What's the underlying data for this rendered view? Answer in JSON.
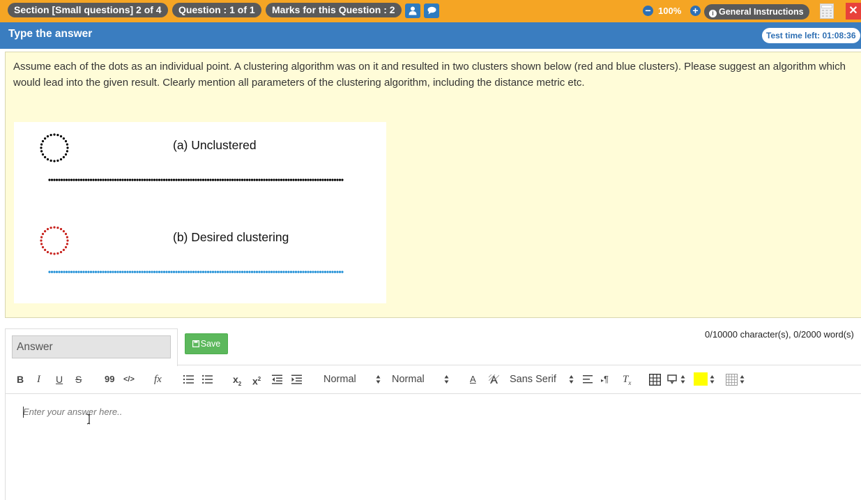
{
  "top_bar": {
    "section_label": "Section [Small questions] 2 of 4",
    "question_label": "Question : 1 of 1",
    "marks_label": "Marks for this Question : 2",
    "zoom_level": "100%",
    "zoom_out_symbol": "−",
    "zoom_in_symbol": "+",
    "info_symbol": "i",
    "general_instructions_label": "General Instructions",
    "close_symbol": "✕",
    "icons": [
      "user-icon",
      "chat-icon",
      "calculator-icon",
      "close-icon"
    ],
    "colors": {
      "bar": "#f5a524",
      "pill": "#5a5a5a",
      "icon_button": "#2e7bbf",
      "close": "#e8413a"
    }
  },
  "header": {
    "title": "Type the answer",
    "timer_label": "Test time left: 01:08:36",
    "color": "#3a7dc0"
  },
  "question": {
    "text": "Assume each of the dots as an individual point. A clustering algorithm was on it and resulted in two clusters shown below (red and blue clusters). Please suggest an algorithm which would lead into the given result. Clearly mention all parameters of the clustering algorithm, including the distance metric etc.",
    "figure": {
      "label_a": "(a) Unclustered",
      "label_b": "(b) Desired clustering",
      "cluster_colors": {
        "unclustered": "#000000",
        "red_cluster": "#c8231e",
        "blue_cluster": "#1f8fd6"
      }
    }
  },
  "answer": {
    "field_label": "Answer",
    "save_label": "Save",
    "counter": "0/10000 character(s), 0/2000 word(s)",
    "placeholder": "Enter your answer here.."
  },
  "toolbar": {
    "bold": "B",
    "italic": "I",
    "underline": "U",
    "strike": "S",
    "quote": "99",
    "code": "</>",
    "formula": "fx",
    "subscript_base": "x",
    "subscript_mark": "2",
    "superscript_base": "x",
    "superscript_mark": "2",
    "header_select": "Normal",
    "size_select": "Normal",
    "font_color_glyph": "A",
    "font_select": "Sans Serif",
    "direction_glyph": "¶",
    "clear_format_glyph": "T",
    "clear_format_mark": "x",
    "highlight_color": "#ffff00",
    "icons": [
      "ordered-list-icon",
      "bullet-list-icon",
      "outdent-icon",
      "indent-icon",
      "background-color-icon",
      "align-icon",
      "table-icon",
      "comment-icon",
      "grid-icon"
    ]
  }
}
